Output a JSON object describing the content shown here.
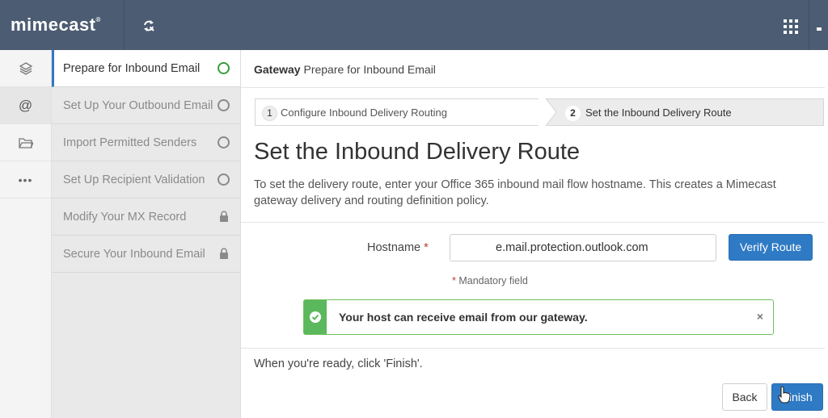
{
  "brand": {
    "logo_text": "mimecast",
    "trademark": "®"
  },
  "rail": {
    "items": [
      "layers-icon",
      "at-icon",
      "folder-icon",
      "more-icon"
    ],
    "active_index": 1
  },
  "steps": [
    {
      "label": "Prepare for Inbound Email",
      "status": "in-progress"
    },
    {
      "label": "Set Up Your Outbound Email",
      "status": "pending"
    },
    {
      "label": "Import Permitted Senders",
      "status": "pending"
    },
    {
      "label": "Set Up Recipient Validation",
      "status": "pending"
    },
    {
      "label": "Modify Your MX Record",
      "status": "locked"
    },
    {
      "label": "Secure Your Inbound Email",
      "status": "locked"
    }
  ],
  "breadcrumb": {
    "section": "Gateway",
    "page": "Prepare for Inbound Email"
  },
  "wizard": {
    "steps": [
      {
        "number": "1",
        "label": "Configure Inbound Delivery Routing"
      },
      {
        "number": "2",
        "label": "Set the Inbound Delivery Route"
      }
    ],
    "active_index": 1
  },
  "main": {
    "title": "Set the Inbound Delivery Route",
    "description": "To set the delivery route, enter your Office 365 inbound mail flow hostname. This creates a Mimecast gateway delivery and routing definition policy.",
    "hostname_label": "Hostname",
    "required_marker": "*",
    "hostname_value": "e.mail.protection.outlook.com",
    "verify_label": "Verify Route",
    "mandatory_text": "Mandatory field",
    "alert_text": "Your host can receive email from our gateway.",
    "alert_close": "×",
    "ready_text": "When you're ready, click 'Finish'.",
    "back_label": "Back",
    "finish_label": "Finish"
  },
  "colors": {
    "topbar": "#4c5c72",
    "accent": "#2f7ac4",
    "success": "#5cb85c",
    "required": "#c0392b"
  }
}
